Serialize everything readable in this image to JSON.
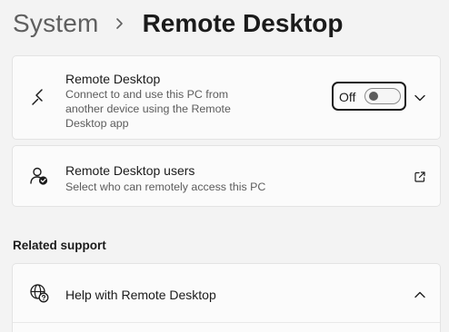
{
  "breadcrumb": {
    "parent": "System",
    "current": "Remote Desktop"
  },
  "remote_desktop": {
    "title": "Remote Desktop",
    "description_lines": [
      "Connect to and use this PC from",
      "another device using the Remote",
      "Desktop app"
    ],
    "toggle": {
      "state_label": "Off",
      "on": false
    },
    "icon": "remote-desktop-icon",
    "expand_icon": "chevron-down-icon"
  },
  "remote_desktop_users": {
    "title": "Remote Desktop users",
    "description": "Select who can remotely access this PC",
    "icon": "user-check-icon",
    "action_icon": "open-external-icon"
  },
  "related_support": {
    "heading": "Related support",
    "help": {
      "title": "Help with Remote Desktop",
      "icon": "globe-help-icon",
      "expand_icon": "chevron-up-icon"
    }
  },
  "colors": {
    "background": "#f3f3f3",
    "card": "#fbfbfb",
    "card_border": "#e3e3e3",
    "text_primary": "#1b1b1b",
    "text_secondary": "#5c5c5c",
    "breadcrumb_parent": "#5f5f5f",
    "focus_border": "#1b1b1b"
  }
}
